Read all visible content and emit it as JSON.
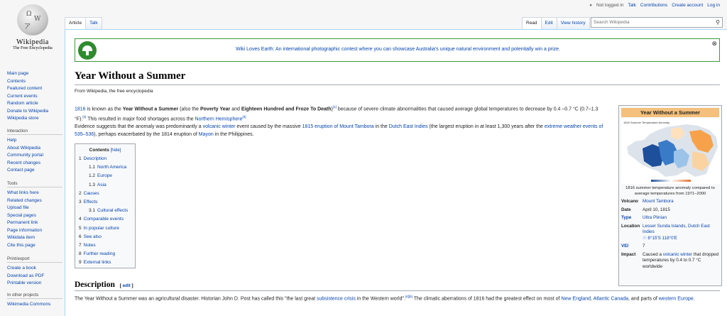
{
  "logo": {
    "wordmark": "Wikipedia",
    "tagline": "The Free Encyclopedia"
  },
  "personal": {
    "status": "Not logged in",
    "talk": "Talk",
    "contributions": "Contributions",
    "create": "Create account",
    "login": "Log in"
  },
  "nav_main": [
    "Main page",
    "Contents",
    "Featured content",
    "Current events",
    "Random article",
    "Donate to Wikipedia",
    "Wikipedia store"
  ],
  "interaction": {
    "heading": "Interaction",
    "items": [
      "Help",
      "About Wikipedia",
      "Community portal",
      "Recent changes",
      "Contact page"
    ]
  },
  "tools": {
    "heading": "Tools",
    "items": [
      "What links here",
      "Related changes",
      "Upload file",
      "Special pages",
      "Permanent link",
      "Page information",
      "Wikidata item",
      "Cite this page"
    ]
  },
  "print": {
    "heading": "Print/export",
    "items": [
      "Create a book",
      "Download as PDF",
      "Printable version"
    ]
  },
  "otherprojects": {
    "heading": "In other projects",
    "items": [
      "Wikimedia Commons"
    ]
  },
  "tabs": {
    "article": "Article",
    "talk": "Talk",
    "read": "Read",
    "edit": "Edit",
    "history": "View history"
  },
  "search": {
    "placeholder": "Search Wikipedia"
  },
  "notice": {
    "text": "Wiki Loves Earth: An international photographic contest where you can showcase Australia's unique natural environment and potentially win a prize."
  },
  "page": {
    "title": "Year Without a Summer",
    "subtitle": "From Wikipedia, the free encyclopedia"
  },
  "lead1": {
    "year": "1816",
    "t1": " is known as the ",
    "b1": "Year Without a Summer",
    "t2": " (also the ",
    "b2": "Poverty Year",
    "t3": " and ",
    "b3": "Eighteen Hundred and Froze To Death",
    "t4": ")",
    "ref1": "[1]",
    "t5": " because of severe climate abnormalities that caused average global temperatures to decrease by 0.4 –0.7 °C (0.7–1.3 °F).",
    "ref2": "[2]",
    "t6": " This resulted in major food shortages across the ",
    "link": "Northern Hemisphere",
    "ref3": "[3]"
  },
  "lead2": {
    "t1": "Evidence suggests that the anomaly was predominantly a ",
    "l1": "volcanic winter",
    "t2": " event caused by the massive ",
    "l2": "1815 eruption of Mount Tambora",
    "t3": " in the ",
    "l3": "Dutch East Indies",
    "t4": " (the largest eruption in at least 1,300 years after the ",
    "l4": "extreme weather events of 535–536",
    "t5": "), perhaps exacerbated by the 1814 eruption of ",
    "l5": "Mayon",
    "t6": " in the Philippines."
  },
  "toc": {
    "title": "Contents",
    "hide": "[hide]",
    "items": [
      {
        "num": "1",
        "label": "Description"
      },
      {
        "num": "1.1",
        "label": "North America"
      },
      {
        "num": "1.2",
        "label": "Europe"
      },
      {
        "num": "1.3",
        "label": "Asia"
      },
      {
        "num": "2",
        "label": "Causes"
      },
      {
        "num": "3",
        "label": "Effects"
      },
      {
        "num": "3.1",
        "label": "Cultural effects"
      },
      {
        "num": "4",
        "label": "Comparable events"
      },
      {
        "num": "5",
        "label": "In popular culture"
      },
      {
        "num": "6",
        "label": "See also"
      },
      {
        "num": "7",
        "label": "Notes"
      },
      {
        "num": "8",
        "label": "Further reading"
      },
      {
        "num": "9",
        "label": "External links"
      }
    ]
  },
  "infobox": {
    "title": "Year Without a Summer",
    "map_title": "1816 Summer Temperature Anomaly",
    "caption": "1816 summer temperature anomaly compared to average temperatures from 1971–2000",
    "rows": {
      "volcano_k": "Volcano",
      "volcano_v": "Mount Tambora",
      "date_k": "Date",
      "date_v": "April 10, 1815",
      "type_k": "Type",
      "type_v": "Ultra Plinian",
      "location_k": "Location",
      "location_v": "Lesser Sunda Islands, Dutch East Indies",
      "coords": "8°15′S 118°0′E",
      "vei_k": "VEI",
      "vei_v": "7",
      "impact_k": "Impact",
      "impact_t1": "Caused a ",
      "impact_link": "volcanic winter",
      "impact_t2": " that dropped temperatures by 0.4 to 0.7 °C worldwide"
    }
  },
  "section": {
    "heading": "Description",
    "edit": "edit"
  },
  "desc": {
    "t1": "The Year Without a Summer was an agricultural disaster. Historian John D. Post has called this \"the last great ",
    "l1": "subsistence crisis",
    "t2": " in the Western world\".",
    "ref": "[4][5]",
    "t3": " The climatic aberrations of 1816 had the greatest effect on most of ",
    "l2": "New England",
    "t4": ", ",
    "l3": "Atlantic Canada",
    "t5": ", and parts of ",
    "l4": "western Europe",
    "t6": "."
  },
  "colors": {
    "link": "#0645ad",
    "notice_border": "#3a9a3a",
    "infobox_header": "#f4c07c"
  }
}
